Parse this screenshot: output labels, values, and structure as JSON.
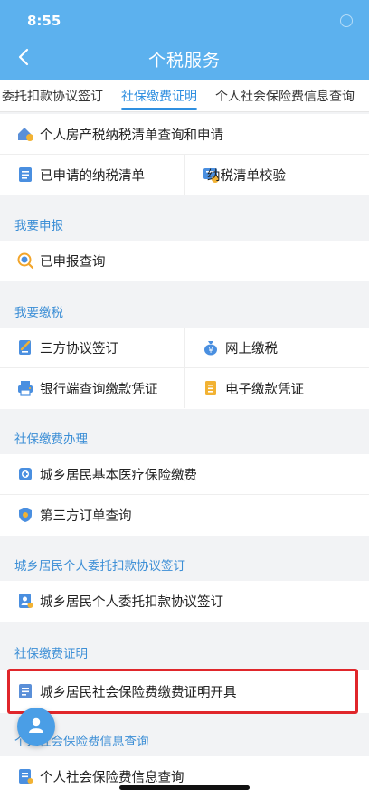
{
  "status_bar": {
    "time": "8:55"
  },
  "header": {
    "title": "个税服务"
  },
  "tabs": [
    {
      "label": "委托扣款协议签订"
    },
    {
      "label": "社保缴费证明"
    },
    {
      "label": "个人社会保险费信息查询"
    }
  ],
  "top_items": {
    "house_tax": "个人房产税纳税清单查询和申请",
    "applied_list": "已申请的纳税清单",
    "verify_list": "纳税清单校验"
  },
  "declare": {
    "title": "我要申报",
    "query": "已申报查询"
  },
  "pay": {
    "title": "我要缴税",
    "tripartite": "三方协议签订",
    "online_pay": "网上缴税",
    "bank_voucher": "银行端查询缴款凭证",
    "e_voucher": "电子缴款凭证"
  },
  "social_pay": {
    "title": "社保缴费办理",
    "medical": "城乡居民基本医疗保险缴费",
    "third_party": "第三方订单查询"
  },
  "entrust": {
    "title": "城乡居民个人委托扣款协议签订",
    "item": "城乡居民个人委托扣款协议签订"
  },
  "certificate": {
    "title": "社保缴费证明",
    "item": "城乡居民社会保险费缴费证明开具"
  },
  "info_query": {
    "title": "个人社会保险费信息查询",
    "item": "个人社会保险费信息查询"
  },
  "colors": {
    "header": "#5cb1ee",
    "accent": "#2f8fe0",
    "section_title": "#3d8fd6",
    "highlight": "#e0262b"
  }
}
